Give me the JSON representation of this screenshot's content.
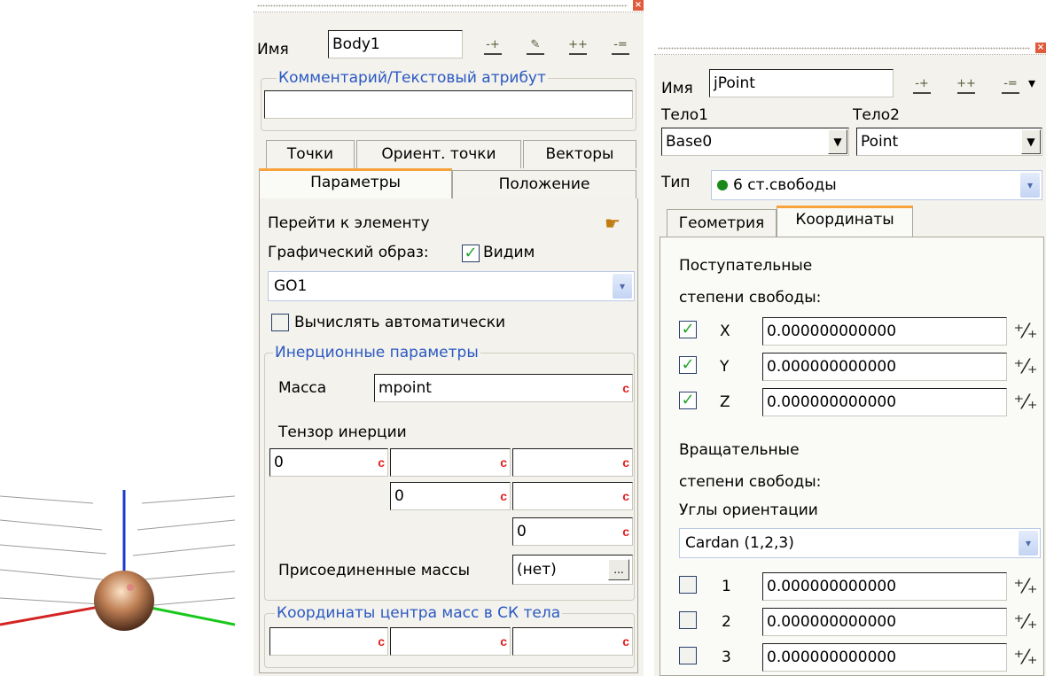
{
  "body_panel": {
    "name_label": "Имя",
    "name_value": "Body1",
    "comment_group": "Комментарий/Текстовый атрибут",
    "comment_value": "",
    "tabs_row1": [
      "Точки",
      "Ориент. точки",
      "Векторы"
    ],
    "tabs_row2": [
      "Параметры",
      "Положение"
    ],
    "goto_label": "Перейти к элементу",
    "graphic_label": "Графический образ:",
    "visible_label": "Видим",
    "graphic_combo": "GO1",
    "auto_calc_label": "Вычислять автоматически",
    "inertia_group": "Инерционные параметры",
    "mass_label": "Масса",
    "mass_value": "mpoint",
    "tensor_label": "Тензор инерции",
    "tensor": {
      "r1c1": "0",
      "r1c2": "",
      "r1c3": "",
      "r2c2": "0",
      "r2c3": "",
      "r3c3": "0"
    },
    "attached_label": "Присоединенные массы",
    "attached_value": "(нет)",
    "mass_center_group": "Координаты центра масс в СК тела",
    "c_symbol": "c",
    "ellipsis": "..."
  },
  "joint_panel": {
    "name_label": "Имя",
    "name_value": "jPoint",
    "body1_label": "Тело1",
    "body2_label": "Тело2",
    "body1_value": "Base0",
    "body2_value": "Point",
    "type_label": "Тип",
    "type_value": "6 ст.свободы",
    "tabs": [
      "Геометрия",
      "Координаты"
    ],
    "trans_line1": "Поступательные",
    "trans_line2": "степени свободы:",
    "trans_rows": [
      {
        "label": "X",
        "value": "0.000000000000"
      },
      {
        "label": "Y",
        "value": "0.000000000000"
      },
      {
        "label": "Z",
        "value": "0.000000000000"
      }
    ],
    "rot_line1": "Вращательные",
    "rot_line2": "степени свободы:",
    "angles_label": "Углы ориентации",
    "angles_value": "Cardan (1,2,3)",
    "rot_rows": [
      {
        "label": "1",
        "value": "0.000000000000"
      },
      {
        "label": "2",
        "value": "0.000000000000"
      },
      {
        "label": "3",
        "value": "0.000000000000"
      }
    ]
  },
  "icons": {
    "check_mark": "✓",
    "combo_arrow": "▾",
    "dropdown_arrow": "▼",
    "spin_glyph": "⁺⁄₊",
    "goto_glyph": "☛",
    "tool_add": "-+",
    "tool_edit": "✎",
    "tool_addmulti": "++",
    "tool_remove": "-=",
    "more": "▾"
  },
  "colors": {
    "accent_blue": "#2b59c3",
    "tab_highlight": "#f7a33a",
    "check_green": "#22a52b",
    "c_red": "#e21f1f"
  }
}
